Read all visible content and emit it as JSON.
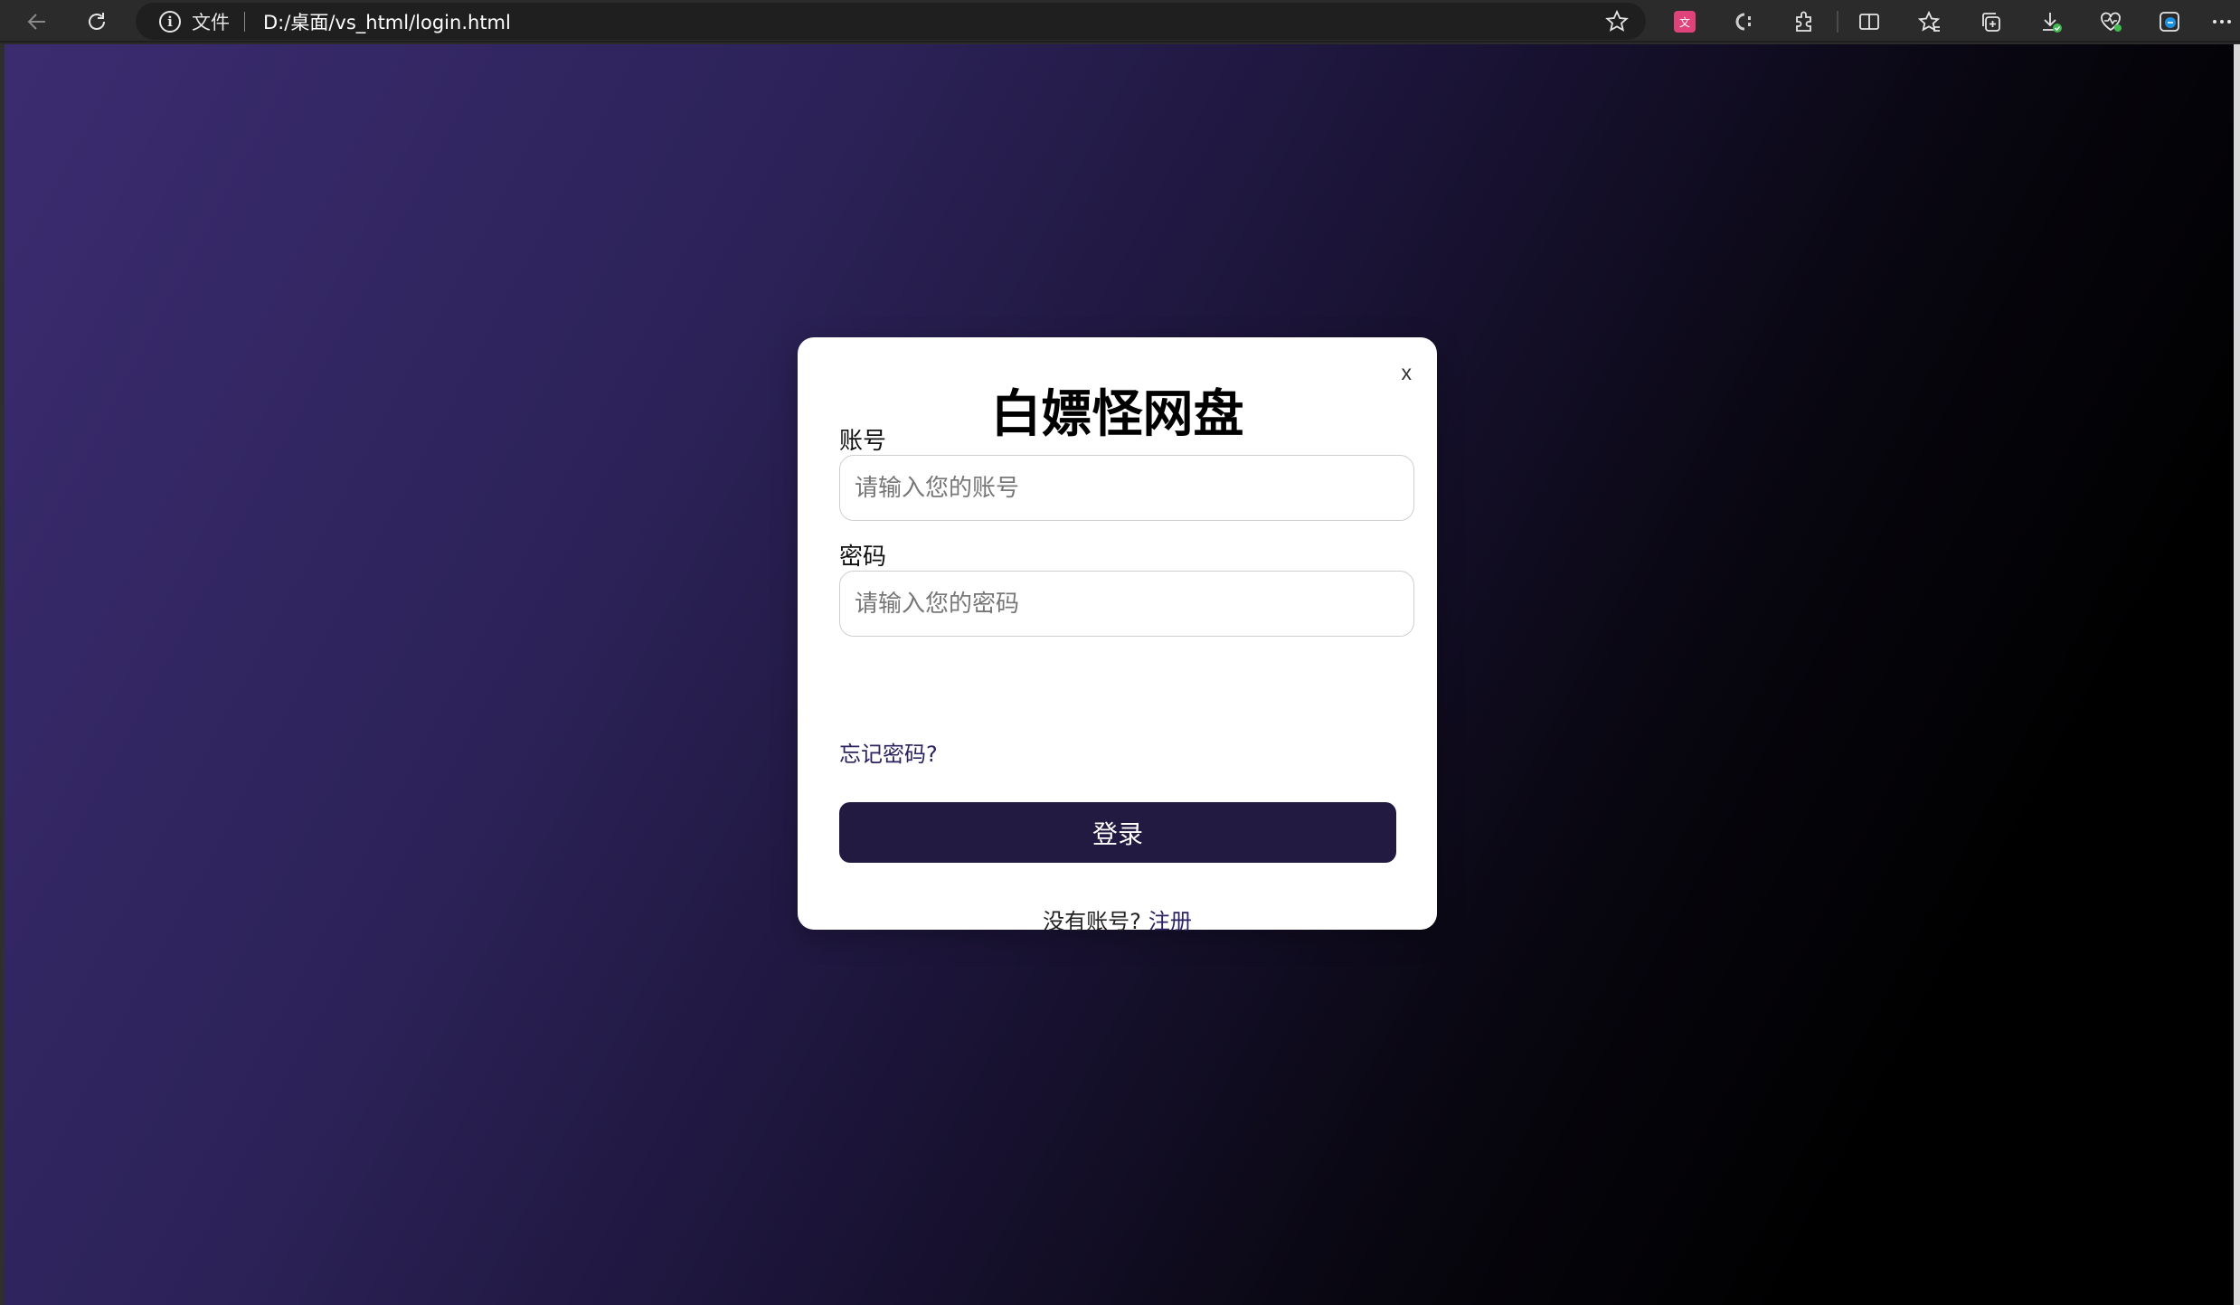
{
  "browser": {
    "address_bar": {
      "scheme_label": "文件",
      "url": "D:/桌面/vs_html/login.html"
    },
    "toolbar_icons": [
      "back-arrow-icon",
      "refresh-icon",
      "info-icon",
      "favorite-star-icon",
      "translate-extension-icon",
      "css-extension-icon",
      "extensions-puzzle-icon",
      "split-screen-icon",
      "favorites-icon",
      "collections-icon",
      "downloads-icon",
      "browser-essentials-icon",
      "edge-copilot-icon",
      "more-menu-icon"
    ]
  },
  "page": {
    "background": {
      "gradient_start": "#3b2c70",
      "gradient_end": "#000000"
    }
  },
  "login_modal": {
    "close_label": "x",
    "title": "白嫖怪网盘",
    "account": {
      "label": "账号",
      "placeholder": "请输入您的账号",
      "value": ""
    },
    "password": {
      "label": "密码",
      "placeholder": "请输入您的密码",
      "value": ""
    },
    "forgot_password": "忘记密码?",
    "login_button": "登录",
    "register_prompt": "没有账号?",
    "register_link": "注册",
    "accent_color": "#221a40"
  }
}
